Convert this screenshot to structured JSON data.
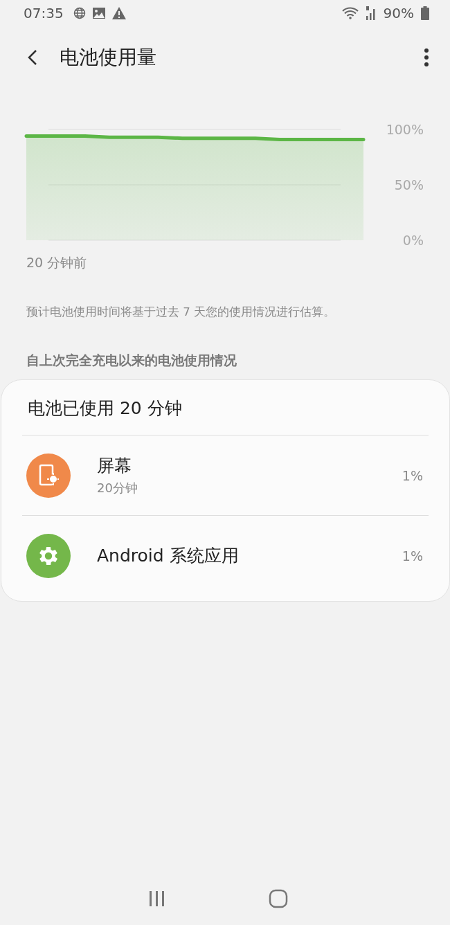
{
  "status_bar": {
    "time": "07:35",
    "battery": "90%"
  },
  "app_bar": {
    "title": "电池使用量"
  },
  "chart": {
    "caption": "20 分钟前",
    "shaded": true,
    "chart_data": {
      "type": "line",
      "categories": [
        null,
        null,
        null,
        null,
        null,
        null,
        null,
        null,
        null,
        null,
        null,
        null
      ],
      "ylim": [
        0,
        100
      ],
      "yticks": [
        {
          "value": 100,
          "label": "100%"
        },
        {
          "value": 50,
          "label": "50%"
        },
        {
          "value": 0,
          "label": "0%"
        }
      ],
      "series": [
        {
          "color": "#5cb646",
          "values": [
            94,
            94,
            93,
            93,
            93,
            92,
            92,
            92,
            92,
            91,
            91,
            91
          ]
        }
      ]
    }
  },
  "note": "预计电池使用时间将基于过去 7 天您的使用情况进行估算。",
  "section_title": "自上次完全充电以来的电池使用情况",
  "card": {
    "summary": "电池已使用 20 分钟",
    "items": [
      {
        "kind": "screen",
        "name": "屏幕",
        "subtitle": "20分钟",
        "percent": "1%",
        "color": "#f0894a"
      },
      {
        "kind": "system",
        "name": "Android 系统应用",
        "percent": "1%",
        "color": "#74b74a"
      }
    ]
  }
}
